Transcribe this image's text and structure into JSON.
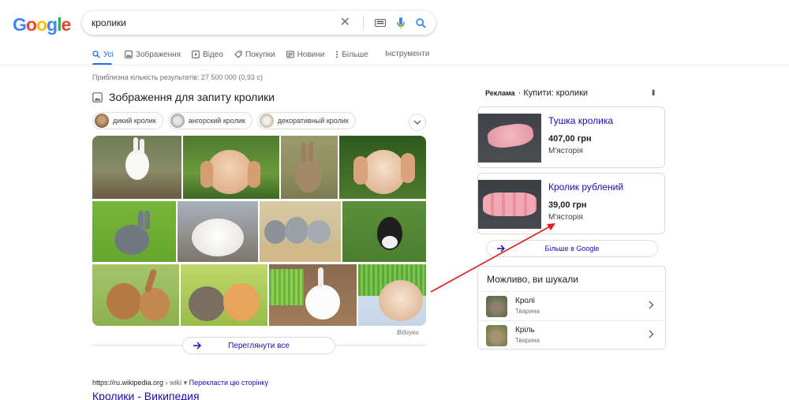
{
  "logo": {
    "text": "Google",
    "letters": [
      "G",
      "o",
      "o",
      "g",
      "l",
      "e"
    ],
    "colors": [
      "#4285f4",
      "#ea4335",
      "#fbbc05",
      "#4285f4",
      "#34a853",
      "#ea4335"
    ]
  },
  "search": {
    "query": "кролики"
  },
  "tabs": [
    {
      "label": "Усі",
      "icon": "search-icon"
    },
    {
      "label": "Зображення",
      "icon": "image-icon"
    },
    {
      "label": "Відео",
      "icon": "video-icon"
    },
    {
      "label": "Покупки",
      "icon": "tag-icon"
    },
    {
      "label": "Новини",
      "icon": "news-icon"
    },
    {
      "label": "Більше",
      "icon": "more-dots-icon"
    }
  ],
  "tools_label": "Інструменти",
  "stats": "Приблизна кількість результатів: 27 500 000 (0,93 с)",
  "images": {
    "title": "Зображення для запиту кролики",
    "chips": [
      "дикий кролик",
      "ангорский кролик",
      "декоративный кролик"
    ],
    "reviews_label": "Відгуки",
    "view_all": "Переглянути все"
  },
  "wiki": {
    "site": "https://ru.wikipedia.org",
    "path": " › wiki",
    "translate": "Перекласти цю сторінку",
    "title": "Кролики - Википедия"
  },
  "ads": {
    "ad_label": "Реклама",
    "title": "· Купити: кролики",
    "items": [
      {
        "title": "Тушка кролика",
        "price": "407,00 грн",
        "shop": "М'ясторія"
      },
      {
        "title": "Кролик рублений",
        "price": "39,00 грн",
        "shop": "М'ясторія"
      }
    ],
    "more": "Більше в Google"
  },
  "also_searched": {
    "title": "Можливо, ви шукали",
    "items": [
      {
        "name": "Кролі",
        "type": "Тварина"
      },
      {
        "name": "Кріль",
        "type": "Тварина"
      }
    ]
  },
  "colors": {
    "link": "#1a0dab",
    "accent": "#1a73e8",
    "annotation": "#e02020"
  }
}
